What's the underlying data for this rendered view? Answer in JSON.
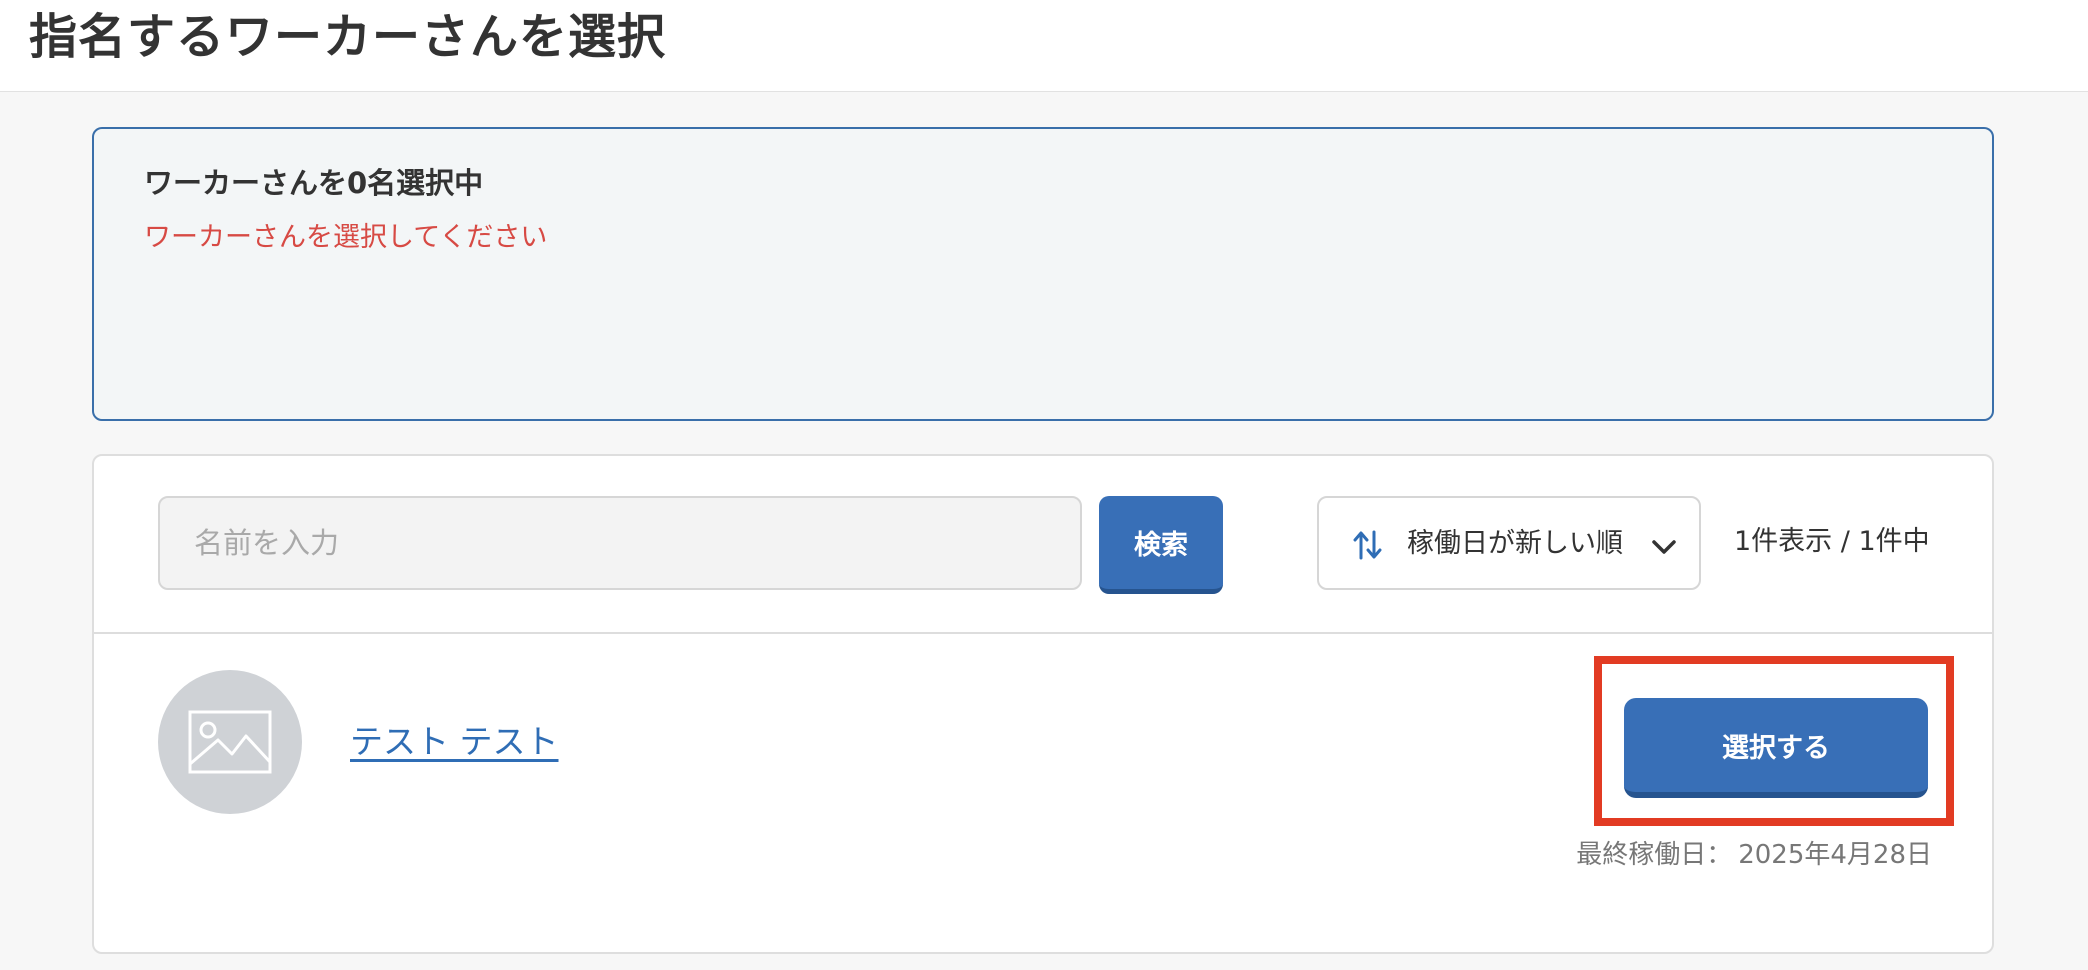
{
  "header": {
    "title": "指名するワーカーさんを選択"
  },
  "selection_summary": {
    "count_text": "ワーカーさんを0名選択中",
    "error_text": "ワーカーさんを選択してください"
  },
  "search": {
    "placeholder": "名前を入力",
    "value": "",
    "button_label": "検索"
  },
  "sort": {
    "selected_label": "稼働日が新しい順",
    "icon": "sort-arrows-icon",
    "dropdown_icon": "chevron-down-icon"
  },
  "result_count": "1件表示 / 1件中",
  "workers": [
    {
      "avatar_icon": "image-placeholder-icon",
      "name": "テスト テスト",
      "select_label": "選択する",
      "last_worked_label": "最終稼働日：",
      "last_worked_date": "2025年4月28日"
    }
  ],
  "colors": {
    "primary": "#386fb7",
    "error": "#d74a44",
    "highlight": "#e23b23",
    "summary_border": "#3a6faa"
  }
}
